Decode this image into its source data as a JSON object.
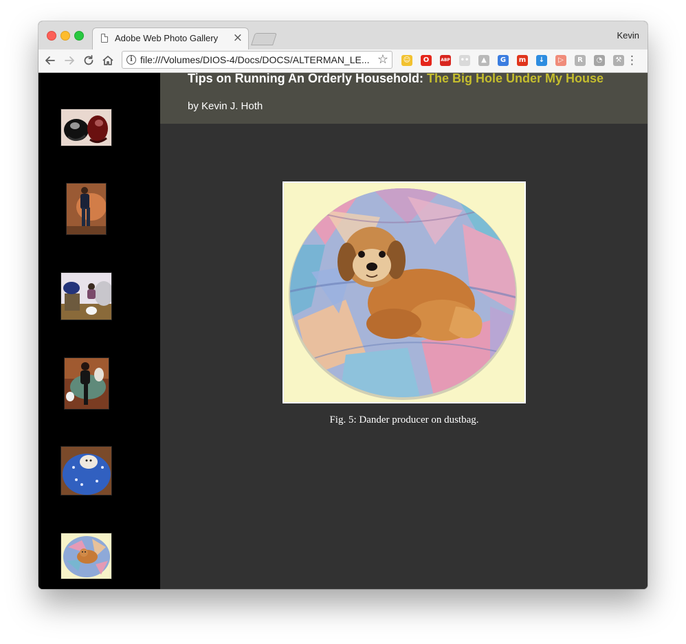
{
  "browser": {
    "tab_title": "Adobe Web Photo Gallery",
    "tab_close_glyph": "×",
    "profile_name": "Kevin",
    "url": "file:///Volumes/DIOS-4/Docs/DOCS/ALTERMAN_LE...",
    "icons": {
      "back": "back-arrow-icon",
      "forward": "forward-arrow-icon",
      "reload": "reload-icon",
      "home": "home-icon",
      "info": "info-icon",
      "star": "bookmark-star-icon",
      "menu": "menu-dots-icon"
    },
    "extensions": [
      {
        "name": "emoji-extension-icon",
        "glyph": "☺",
        "color": "#f2c230"
      },
      {
        "name": "opera-extension-icon",
        "glyph": "O",
        "color": "#e5261b"
      },
      {
        "name": "adblock-plus-icon",
        "glyph": "ABP",
        "color": "#d8261f"
      },
      {
        "name": "flickr-extension-icon",
        "glyph": "••",
        "color": "#d9d9d9"
      },
      {
        "name": "drive-extension-icon",
        "glyph": "▲",
        "color": "#b9b9b9"
      },
      {
        "name": "translate-extension-icon",
        "glyph": "G",
        "color": "#3b7de0"
      },
      {
        "name": "m-extension-icon",
        "glyph": "m",
        "color": "#e0351c"
      },
      {
        "name": "download-extension-icon",
        "glyph": "↓",
        "color": "#2e8de0"
      },
      {
        "name": "cast-extension-icon",
        "glyph": "▷",
        "color": "#f08c7a"
      },
      {
        "name": "r-extension-icon",
        "glyph": "R",
        "color": "#b5b5b5"
      },
      {
        "name": "satellite-extension-icon",
        "glyph": "◔",
        "color": "#a5a5a5"
      },
      {
        "name": "wrench-extension-icon",
        "glyph": "⚒",
        "color": "#b0b0b0"
      }
    ]
  },
  "gallery": {
    "title_main": "Tips on Running An Orderly Household: ",
    "title_sub": "The Big Hole Under My House",
    "author": "by Kevin J. Hoth",
    "caption": "Fig. 5: Dander producer on dustbag.",
    "colors": {
      "sidebar": "#000000",
      "header_band": "#4d4d45",
      "page_bg": "#323232",
      "title_accent": "#c4bd2e"
    },
    "thumbnails": [
      {
        "name": "thumbnail-shoes"
      },
      {
        "name": "thumbnail-man-beanbag"
      },
      {
        "name": "thumbnail-woman-dog-room"
      },
      {
        "name": "thumbnail-woman-beanbag-dog"
      },
      {
        "name": "thumbnail-dog-blue-beanbag"
      },
      {
        "name": "thumbnail-dog-patchwork-beanbag"
      }
    ]
  }
}
